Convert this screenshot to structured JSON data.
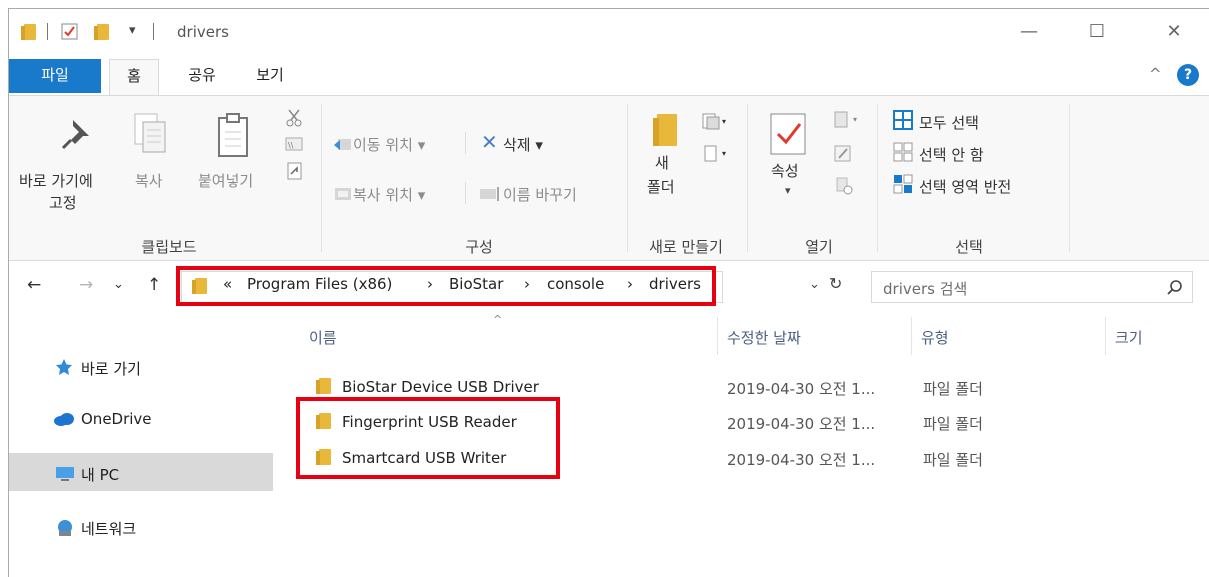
{
  "window": {
    "title": "drivers",
    "qat_dropdown": "▾",
    "minimize": "—",
    "maximize": "☐",
    "close": "✕"
  },
  "tabs": [
    {
      "label": "파일"
    },
    {
      "label": "홈"
    },
    {
      "label": "공유"
    },
    {
      "label": "보기"
    }
  ],
  "ribbon": {
    "pin_label_1": "바로 가기에",
    "pin_label_2": "고정",
    "copy_label": "복사",
    "paste_label": "붙여넣기",
    "clipboard_group": "클립보드",
    "move_to_label": "이동 위치",
    "copy_to_label": "복사 위치",
    "delete_label": "삭제",
    "rename_label": "이름 바꾸기",
    "organize_group": "구성",
    "new_folder_label_1": "새",
    "new_folder_label_2": "폴더",
    "new_group": "새로 만들기",
    "properties_label": "속성",
    "open_group": "열기",
    "select_all_label": "모두 선택",
    "select_none_label": "선택 안 함",
    "invert_selection_label": "선택 영역 반전",
    "select_group": "선택",
    "collapse_glyph": "^",
    "help_glyph": "?"
  },
  "address": {
    "back": "←",
    "forward": "→",
    "recent": "⌄",
    "up": "↑",
    "overflow": "«",
    "crumbs": [
      "Program Files (x86)",
      "BioStar",
      "console",
      "drivers"
    ],
    "crumb_sep": "›",
    "dropdown": "⌄",
    "refresh": "↻",
    "search_placeholder": "drivers 검색"
  },
  "navpane": {
    "items": [
      {
        "label": "바로 가기"
      },
      {
        "label": "OneDrive"
      },
      {
        "label": "내 PC"
      },
      {
        "label": "네트워크"
      }
    ]
  },
  "columns": {
    "name": "이름",
    "date": "수정한 날짜",
    "type": "유형",
    "size": "크기",
    "sort_glyph": "^"
  },
  "files": [
    {
      "name": "BioStar Device USB Driver",
      "date": "2019-04-30 오전 1...",
      "type": "파일 폴더"
    },
    {
      "name": "Fingerprint USB Reader",
      "date": "2019-04-30 오전 1...",
      "type": "파일 폴더"
    },
    {
      "name": "Smartcard USB Writer",
      "date": "2019-04-30 오전 1...",
      "type": "파일 폴더"
    }
  ],
  "colors": {
    "accent": "#1979ca",
    "highlight": "#e60012",
    "folder": "#e8b83a"
  }
}
